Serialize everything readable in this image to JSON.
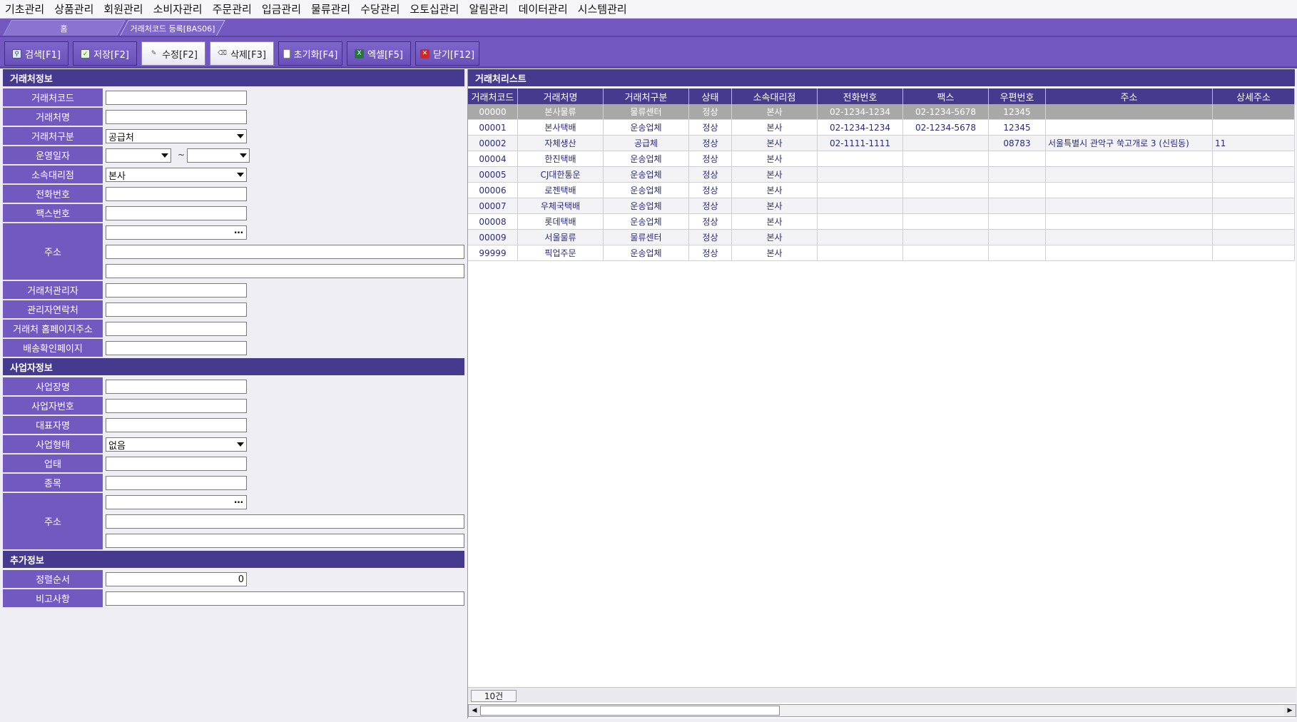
{
  "menu": [
    "기초관리",
    "상품관리",
    "회원관리",
    "소비자관리",
    "주문관리",
    "입금관리",
    "물류관리",
    "수당관리",
    "오토십관리",
    "알림관리",
    "데이터관리",
    "시스템관리"
  ],
  "tabs": {
    "home": "홈",
    "current": "거래처코드 등록[BAS06]"
  },
  "toolbar": {
    "search": "검색[F1]",
    "save": "저장[F2]",
    "edit": "수정[F2]",
    "delete": "삭제[F3]",
    "reset": "초기화[F4]",
    "excel": "엑셀[F5]",
    "close": "닫기[F12]"
  },
  "sections": {
    "client_info": "거래처정보",
    "business_info": "사업자정보",
    "extra_info": "추가정보",
    "client_list": "거래처리스트"
  },
  "form": {
    "client_code": {
      "label": "거래처코드",
      "value": ""
    },
    "client_name": {
      "label": "거래처명",
      "value": ""
    },
    "client_type": {
      "label": "거래처구분",
      "value": "공급처"
    },
    "operating_period": {
      "label": "운영일자",
      "from": "",
      "to": "",
      "sep": "~"
    },
    "branch": {
      "label": "소속대리점",
      "value": "본사"
    },
    "phone": {
      "label": "전화번호",
      "value": ""
    },
    "fax": {
      "label": "팩스번호",
      "value": ""
    },
    "address": {
      "label": "주소",
      "zip": "",
      "line1": "",
      "line2": ""
    },
    "manager": {
      "label": "거래처관리자",
      "value": ""
    },
    "manager_contact": {
      "label": "관리자연락처",
      "value": ""
    },
    "homepage": {
      "label": "거래처 홈페이지주소",
      "value": ""
    },
    "delivery_page": {
      "label": "배송확인페이지",
      "value": ""
    },
    "business_name": {
      "label": "사업장명",
      "value": ""
    },
    "business_number": {
      "label": "사업자번호",
      "value": ""
    },
    "representative": {
      "label": "대표자명",
      "value": ""
    },
    "business_type": {
      "label": "사업형태",
      "value": "없음"
    },
    "industry": {
      "label": "업태",
      "value": ""
    },
    "item": {
      "label": "종목",
      "value": ""
    },
    "biz_address": {
      "label": "주소",
      "zip": "",
      "line1": "",
      "line2": ""
    },
    "sort_order": {
      "label": "정렬순서",
      "value": "0"
    },
    "remarks": {
      "label": "비고사항",
      "value": ""
    }
  },
  "grid": {
    "columns": [
      "거래처코드",
      "거래처명",
      "거래처구분",
      "상태",
      "소속대리점",
      "전화번호",
      "팩스",
      "우편번호",
      "주소",
      "상세주소"
    ],
    "rows": [
      [
        "00000",
        "본사물류",
        "물류센터",
        "정상",
        "본사",
        "02-1234-1234",
        "02-1234-5678",
        "12345",
        "",
        ""
      ],
      [
        "00001",
        "본사택배",
        "운송업체",
        "정상",
        "본사",
        "02-1234-1234",
        "02-1234-5678",
        "12345",
        "",
        ""
      ],
      [
        "00002",
        "자체생산",
        "공급체",
        "정상",
        "본사",
        "02-1111-1111",
        "",
        "08783",
        "서울특별시 관악구 쑥고개로 3 (신림동)",
        "11"
      ],
      [
        "00004",
        "한진택배",
        "운송업체",
        "정상",
        "본사",
        "",
        "",
        "",
        "",
        ""
      ],
      [
        "00005",
        "CJ대한통운",
        "운송업체",
        "정상",
        "본사",
        "",
        "",
        "",
        "",
        ""
      ],
      [
        "00006",
        "로젠택배",
        "운송업체",
        "정상",
        "본사",
        "",
        "",
        "",
        "",
        ""
      ],
      [
        "00007",
        "우체국택배",
        "운송업체",
        "정상",
        "본사",
        "",
        "",
        "",
        "",
        ""
      ],
      [
        "00008",
        "롯데택배",
        "운송업체",
        "정상",
        "본사",
        "",
        "",
        "",
        "",
        ""
      ],
      [
        "00009",
        "서울물류",
        "물류센터",
        "정상",
        "본사",
        "",
        "",
        "",
        "",
        ""
      ],
      [
        "99999",
        "픽업주문",
        "운송업체",
        "정상",
        "본사",
        "",
        "",
        "",
        "",
        ""
      ]
    ],
    "count": "10건"
  },
  "colors": {
    "primary": "#7358bf",
    "header": "#463a8e",
    "selected_row": "#a8a8a8"
  }
}
